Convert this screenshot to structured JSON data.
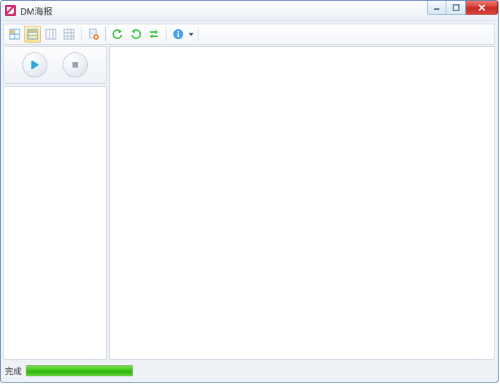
{
  "window": {
    "title": "DM海报"
  },
  "status": {
    "text": "完成",
    "progress_percent": 100
  },
  "toolbar": {
    "icons": {
      "view1": "grid-blue",
      "view2": "grid-selected",
      "view3": "columns",
      "view4": "grid-plain",
      "page_add": "page-add",
      "refresh1": "refresh-ccw",
      "refresh2": "refresh-ccw-alt",
      "refresh3": "swap",
      "info": "info"
    }
  },
  "colors": {
    "accent_green": "#37c011",
    "info_blue": "#1e90ff",
    "close_red": "#d9413a"
  }
}
